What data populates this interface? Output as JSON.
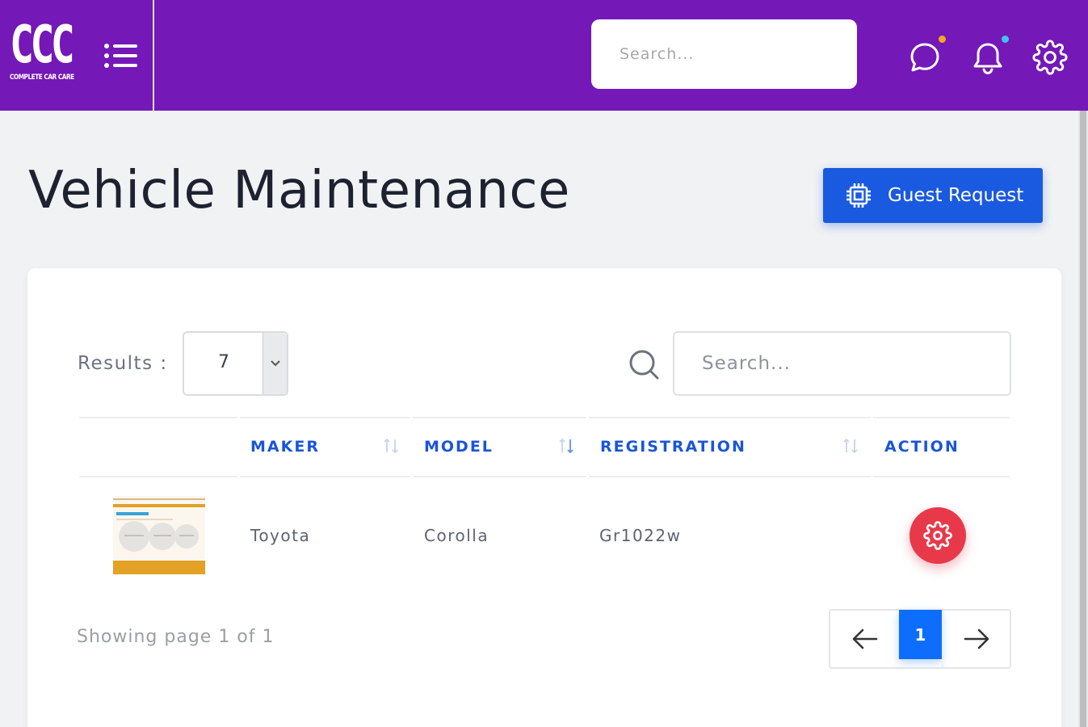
{
  "header": {
    "logo_text": "CCC",
    "logo_subtext": "COMPLETE CAR CARE",
    "search_placeholder": "Search...",
    "icons": [
      "menu-icon",
      "chat-icon",
      "bell-icon",
      "gear-icon"
    ],
    "chat_dot_color": "#f5a623",
    "bell_dot_color": "#3fc3ee",
    "brand_color": "#7418b8"
  },
  "page": {
    "title": "Vehicle Maintenance",
    "guest_request_label": "Guest Request",
    "guest_request_icon": "chip-icon",
    "accent_color": "#1a5ae0"
  },
  "table_controls": {
    "results_label": "Results :",
    "results_value": "7",
    "search_placeholder": "Search..."
  },
  "table": {
    "columns": [
      "MAKER",
      "MODEL",
      "REGISTRATION",
      "ACTION"
    ],
    "rows": [
      {
        "maker": "Toyota",
        "model": "Corolla",
        "registration": "Gr1022w",
        "action_icon": "gear-icon"
      }
    ]
  },
  "pagination": {
    "showing_text": "Showing page 1 of 1",
    "current_page": "1",
    "prev_icon": "arrow-left-icon",
    "next_icon": "arrow-right-icon"
  }
}
